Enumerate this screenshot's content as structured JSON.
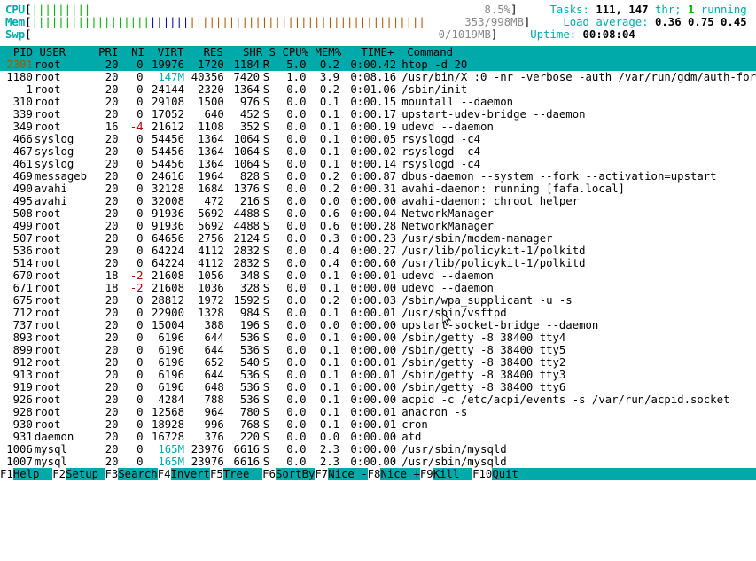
{
  "meters": {
    "cpu": {
      "label": "CPU",
      "bars": "|||||||||",
      "pct": "8.5%"
    },
    "mem": {
      "label": "Mem",
      "bars": "|||||||||||||||||||||||||||||||||||||||||||||||||||||||||||||",
      "used": "353",
      "total": "998MB"
    },
    "swp": {
      "label": "Swp",
      "bars": "",
      "used": "0",
      "total": "1019MB"
    }
  },
  "sys": {
    "tasks_label": "Tasks: ",
    "tasks": "111, 147",
    "thr": " thr; ",
    "running": "1",
    "running_lbl": " running",
    "load_label": "Load average: ",
    "load": "0.36 0.75 0.45",
    "uptime_label": "Uptime: ",
    "uptime": "00:08:04"
  },
  "cols": [
    "PID",
    "USER",
    "PRI",
    "NI",
    "VIRT",
    "RES",
    "SHR",
    "S",
    "CPU%",
    "MEM%",
    "TIME+",
    "Command"
  ],
  "highlight": {
    "pid": "2301",
    "user": "root",
    "pri": "20",
    "ni": "0",
    "virt": "19976",
    "res": "1720",
    "shr": "1184",
    "s": "R",
    "cpu": "5.0",
    "mem": "0.2",
    "time": "0:00.42",
    "cmd": "htop -d 20"
  },
  "procs": [
    {
      "pid": "1180",
      "user": "root",
      "pri": "20",
      "ni": "0",
      "virt": "147M",
      "res": "40356",
      "shr": "7420",
      "s": "S",
      "cpu": "1.0",
      "mem": "3.9",
      "time": "0:08.16",
      "cmd": "/usr/bin/X :0 -nr -verbose -auth /var/run/gdm/auth-for"
    },
    {
      "pid": "1",
      "user": "root",
      "pri": "20",
      "ni": "0",
      "virt": "24144",
      "res": "2320",
      "shr": "1364",
      "s": "S",
      "cpu": "0.0",
      "mem": "0.2",
      "time": "0:01.06",
      "cmd": "/sbin/init"
    },
    {
      "pid": "310",
      "user": "root",
      "pri": "20",
      "ni": "0",
      "virt": "29108",
      "res": "1500",
      "shr": "976",
      "s": "S",
      "cpu": "0.0",
      "mem": "0.1",
      "time": "0:00.15",
      "cmd": "mountall --daemon"
    },
    {
      "pid": "339",
      "user": "root",
      "pri": "20",
      "ni": "0",
      "virt": "17052",
      "res": "640",
      "shr": "452",
      "s": "S",
      "cpu": "0.0",
      "mem": "0.1",
      "time": "0:00.17",
      "cmd": "upstart-udev-bridge --daemon"
    },
    {
      "pid": "349",
      "user": "root",
      "pri": "16",
      "ni": "-4",
      "virt": "21612",
      "res": "1108",
      "shr": "352",
      "s": "S",
      "cpu": "0.0",
      "mem": "0.1",
      "time": "0:00.19",
      "cmd": "udevd --daemon"
    },
    {
      "pid": "466",
      "user": "syslog",
      "pri": "20",
      "ni": "0",
      "virt": "54456",
      "res": "1364",
      "shr": "1064",
      "s": "S",
      "cpu": "0.0",
      "mem": "0.1",
      "time": "0:00.05",
      "cmd": "rsyslogd -c4"
    },
    {
      "pid": "467",
      "user": "syslog",
      "pri": "20",
      "ni": "0",
      "virt": "54456",
      "res": "1364",
      "shr": "1064",
      "s": "S",
      "cpu": "0.0",
      "mem": "0.1",
      "time": "0:00.02",
      "cmd": "rsyslogd -c4"
    },
    {
      "pid": "461",
      "user": "syslog",
      "pri": "20",
      "ni": "0",
      "virt": "54456",
      "res": "1364",
      "shr": "1064",
      "s": "S",
      "cpu": "0.0",
      "mem": "0.1",
      "time": "0:00.14",
      "cmd": "rsyslogd -c4"
    },
    {
      "pid": "469",
      "user": "messageb",
      "pri": "20",
      "ni": "0",
      "virt": "24616",
      "res": "1964",
      "shr": "828",
      "s": "S",
      "cpu": "0.0",
      "mem": "0.2",
      "time": "0:00.87",
      "cmd": "dbus-daemon --system --fork --activation=upstart"
    },
    {
      "pid": "490",
      "user": "avahi",
      "pri": "20",
      "ni": "0",
      "virt": "32128",
      "res": "1684",
      "shr": "1376",
      "s": "S",
      "cpu": "0.0",
      "mem": "0.2",
      "time": "0:00.31",
      "cmd": "avahi-daemon: running [fafa.local]"
    },
    {
      "pid": "495",
      "user": "avahi",
      "pri": "20",
      "ni": "0",
      "virt": "32008",
      "res": "472",
      "shr": "216",
      "s": "S",
      "cpu": "0.0",
      "mem": "0.0",
      "time": "0:00.00",
      "cmd": "avahi-daemon: chroot helper"
    },
    {
      "pid": "508",
      "user": "root",
      "pri": "20",
      "ni": "0",
      "virt": "91936",
      "res": "5692",
      "shr": "4488",
      "s": "S",
      "cpu": "0.0",
      "mem": "0.6",
      "time": "0:00.04",
      "cmd": "NetworkManager"
    },
    {
      "pid": "499",
      "user": "root",
      "pri": "20",
      "ni": "0",
      "virt": "91936",
      "res": "5692",
      "shr": "4488",
      "s": "S",
      "cpu": "0.0",
      "mem": "0.6",
      "time": "0:00.28",
      "cmd": "NetworkManager"
    },
    {
      "pid": "507",
      "user": "root",
      "pri": "20",
      "ni": "0",
      "virt": "64656",
      "res": "2756",
      "shr": "2124",
      "s": "S",
      "cpu": "0.0",
      "mem": "0.3",
      "time": "0:00.23",
      "cmd": "/usr/sbin/modem-manager"
    },
    {
      "pid": "536",
      "user": "root",
      "pri": "20",
      "ni": "0",
      "virt": "64224",
      "res": "4112",
      "shr": "2832",
      "s": "S",
      "cpu": "0.0",
      "mem": "0.4",
      "time": "0:00.27",
      "cmd": "/usr/lib/policykit-1/polkitd"
    },
    {
      "pid": "514",
      "user": "root",
      "pri": "20",
      "ni": "0",
      "virt": "64224",
      "res": "4112",
      "shr": "2832",
      "s": "S",
      "cpu": "0.0",
      "mem": "0.4",
      "time": "0:00.60",
      "cmd": "/usr/lib/policykit-1/polkitd"
    },
    {
      "pid": "670",
      "user": "root",
      "pri": "18",
      "ni": "-2",
      "virt": "21608",
      "res": "1056",
      "shr": "348",
      "s": "S",
      "cpu": "0.0",
      "mem": "0.1",
      "time": "0:00.01",
      "cmd": "udevd --daemon"
    },
    {
      "pid": "671",
      "user": "root",
      "pri": "18",
      "ni": "-2",
      "virt": "21608",
      "res": "1036",
      "shr": "328",
      "s": "S",
      "cpu": "0.0",
      "mem": "0.1",
      "time": "0:00.00",
      "cmd": "udevd --daemon"
    },
    {
      "pid": "675",
      "user": "root",
      "pri": "20",
      "ni": "0",
      "virt": "28812",
      "res": "1972",
      "shr": "1592",
      "s": "S",
      "cpu": "0.0",
      "mem": "0.2",
      "time": "0:00.03",
      "cmd": "/sbin/wpa_supplicant -u -s"
    },
    {
      "pid": "712",
      "user": "root",
      "pri": "20",
      "ni": "0",
      "virt": "22900",
      "res": "1328",
      "shr": "984",
      "s": "S",
      "cpu": "0.0",
      "mem": "0.1",
      "time": "0:00.01",
      "cmd": "/usr/sbin/vsftpd"
    },
    {
      "pid": "737",
      "user": "root",
      "pri": "20",
      "ni": "0",
      "virt": "15004",
      "res": "388",
      "shr": "196",
      "s": "S",
      "cpu": "0.0",
      "mem": "0.0",
      "time": "0:00.00",
      "cmd": "upstart-socket-bridge --daemon"
    },
    {
      "pid": "893",
      "user": "root",
      "pri": "20",
      "ni": "0",
      "virt": "6196",
      "res": "644",
      "shr": "536",
      "s": "S",
      "cpu": "0.0",
      "mem": "0.1",
      "time": "0:00.00",
      "cmd": "/sbin/getty -8 38400 tty4"
    },
    {
      "pid": "899",
      "user": "root",
      "pri": "20",
      "ni": "0",
      "virt": "6196",
      "res": "644",
      "shr": "536",
      "s": "S",
      "cpu": "0.0",
      "mem": "0.1",
      "time": "0:00.00",
      "cmd": "/sbin/getty -8 38400 tty5"
    },
    {
      "pid": "912",
      "user": "root",
      "pri": "20",
      "ni": "0",
      "virt": "6196",
      "res": "652",
      "shr": "540",
      "s": "S",
      "cpu": "0.0",
      "mem": "0.1",
      "time": "0:00.01",
      "cmd": "/sbin/getty -8 38400 tty2"
    },
    {
      "pid": "913",
      "user": "root",
      "pri": "20",
      "ni": "0",
      "virt": "6196",
      "res": "644",
      "shr": "536",
      "s": "S",
      "cpu": "0.0",
      "mem": "0.1",
      "time": "0:00.01",
      "cmd": "/sbin/getty -8 38400 tty3"
    },
    {
      "pid": "919",
      "user": "root",
      "pri": "20",
      "ni": "0",
      "virt": "6196",
      "res": "648",
      "shr": "536",
      "s": "S",
      "cpu": "0.0",
      "mem": "0.1",
      "time": "0:00.00",
      "cmd": "/sbin/getty -8 38400 tty6"
    },
    {
      "pid": "926",
      "user": "root",
      "pri": "20",
      "ni": "0",
      "virt": "4284",
      "res": "788",
      "shr": "536",
      "s": "S",
      "cpu": "0.0",
      "mem": "0.1",
      "time": "0:00.00",
      "cmd": "acpid -c /etc/acpi/events -s /var/run/acpid.socket"
    },
    {
      "pid": "928",
      "user": "root",
      "pri": "20",
      "ni": "0",
      "virt": "12568",
      "res": "964",
      "shr": "780",
      "s": "S",
      "cpu": "0.0",
      "mem": "0.1",
      "time": "0:00.01",
      "cmd": "anacron -s"
    },
    {
      "pid": "930",
      "user": "root",
      "pri": "20",
      "ni": "0",
      "virt": "18928",
      "res": "996",
      "shr": "768",
      "s": "S",
      "cpu": "0.0",
      "mem": "0.1",
      "time": "0:00.01",
      "cmd": "cron"
    },
    {
      "pid": "931",
      "user": "daemon",
      "pri": "20",
      "ni": "0",
      "virt": "16728",
      "res": "376",
      "shr": "220",
      "s": "S",
      "cpu": "0.0",
      "mem": "0.0",
      "time": "0:00.00",
      "cmd": "atd"
    },
    {
      "pid": "1006",
      "user": "mysql",
      "pri": "20",
      "ni": "0",
      "virt": "165M",
      "res": "23976",
      "shr": "6616",
      "s": "S",
      "cpu": "0.0",
      "mem": "2.3",
      "time": "0:00.00",
      "cmd": "/usr/sbin/mysqld"
    },
    {
      "pid": "1007",
      "user": "mysql",
      "pri": "20",
      "ni": "0",
      "virt": "165M",
      "res": "23976",
      "shr": "6616",
      "s": "S",
      "cpu": "0.0",
      "mem": "2.3",
      "time": "0:00.00",
      "cmd": "/usr/sbin/mysqld"
    }
  ],
  "fkeys": [
    {
      "k": "F1",
      "l": "Help"
    },
    {
      "k": "F2",
      "l": "Setup"
    },
    {
      "k": "F3",
      "l": "Search"
    },
    {
      "k": "F4",
      "l": "Invert"
    },
    {
      "k": "F5",
      "l": "Tree"
    },
    {
      "k": "F6",
      "l": "SortBy"
    },
    {
      "k": "F7",
      "l": "Nice -"
    },
    {
      "k": "F8",
      "l": "Nice +"
    },
    {
      "k": "F9",
      "l": "Kill"
    },
    {
      "k": "F10",
      "l": "Quit"
    }
  ]
}
